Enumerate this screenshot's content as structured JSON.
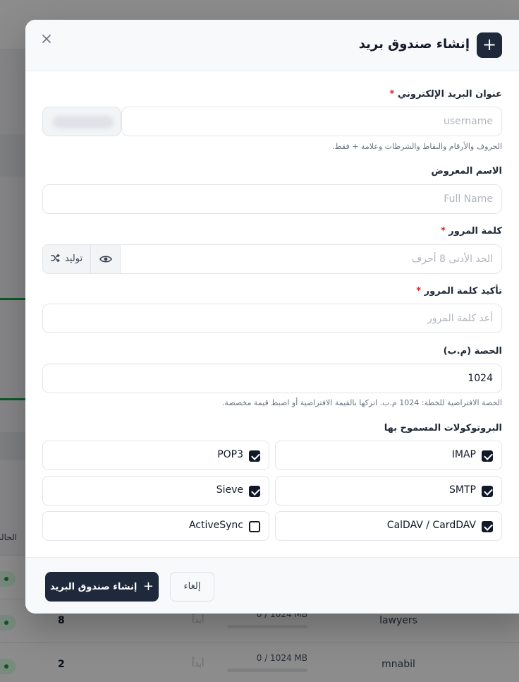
{
  "background": {
    "column_header": "الحالة",
    "rows": [
      {
        "count": "",
        "last_login": "",
        "quota": "",
        "domain": ""
      },
      {
        "count": "8",
        "last_login": "أبداً",
        "quota": "0 / 1024 MB",
        "domain": "lawyers"
      },
      {
        "count": "2",
        "last_login": "أبداً",
        "quota": "0 / 1024 MB",
        "domain": "mnabil"
      }
    ]
  },
  "modal": {
    "title": "إنشاء صندوق بريد",
    "header_icon": "plus-icon",
    "close_icon": "close-icon",
    "email": {
      "label": "عنوان البريد الإلكتروني",
      "placeholder": "username",
      "value": "",
      "hint": "الحروف والأرقام والنقاط والشرطات وعلامة + فقط."
    },
    "display_name": {
      "label": "الاسم المعروض",
      "placeholder": "Full Name",
      "value": ""
    },
    "password": {
      "label": "كلمة المرور",
      "placeholder": "الحد الأدنى 8 أحرف",
      "value": "",
      "generate_label": "توليد",
      "eye_icon": "eye-icon",
      "shuffle_icon": "shuffle-icon"
    },
    "confirm_password": {
      "label": "تأكيد كلمة المرور",
      "placeholder": "أعد كلمة المرور",
      "value": ""
    },
    "quota": {
      "label": "الحصة (م.ب)",
      "value": "1024",
      "hint": "الحصة الافتراضية للخطة: 1024 م.ب. اتركها بالقيمة الافتراضية أو اضبط قيمة مخصصة."
    },
    "protocols": {
      "label": "البروتوكولات المسموح بها",
      "items": [
        {
          "name": "IMAP",
          "checked": true
        },
        {
          "name": "POP3",
          "checked": true
        },
        {
          "name": "SMTP",
          "checked": true
        },
        {
          "name": "Sieve",
          "checked": true
        },
        {
          "name": "CalDAV / CardDAV",
          "checked": true
        },
        {
          "name": "ActiveSync",
          "checked": false
        }
      ]
    },
    "footer": {
      "create_label": "إنشاء صندوق البريد",
      "cancel_label": "إلغاء"
    }
  },
  "colors": {
    "primary": "#1e293b",
    "required": "#dc2626",
    "status_green": "#16a34a"
  }
}
